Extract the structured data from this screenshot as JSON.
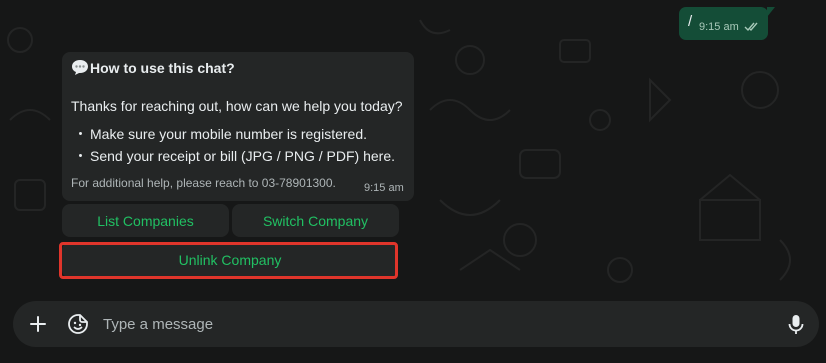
{
  "messages": {
    "sent": {
      "text": "/",
      "time": "9:15 am",
      "status_icon": "double-check-icon"
    },
    "received": {
      "title": "How to use this chat?",
      "title_icon": "speech-bubble-icon",
      "greeting": "Thanks for reaching out, how can we help you today?",
      "bullets": [
        "Make sure your mobile number is registered.",
        "Send your receipt or bill (JPG / PNG / PDF) here."
      ],
      "bullet_symbol": "・",
      "footer": "For additional help, please reach to 03-78901300.",
      "time": "9:15 am"
    }
  },
  "quick_replies": {
    "list": "List Companies",
    "switch": "Switch Company",
    "unlink": "Unlink Company"
  },
  "composer": {
    "placeholder": "Type a message",
    "icons": [
      "plus-icon",
      "sticker-icon",
      "microphone-icon"
    ]
  },
  "colors": {
    "background": "#161717",
    "bubble_incoming": "#242626",
    "bubble_outgoing": "#144d37",
    "accent_green": "#21c063",
    "highlight_red": "#e0352b"
  }
}
